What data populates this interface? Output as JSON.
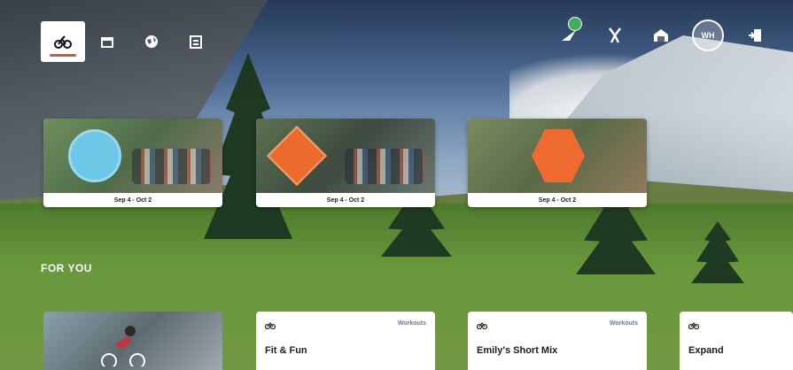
{
  "nav": {
    "left_icons": [
      {
        "name": "ride-icon",
        "active": true
      },
      {
        "name": "calendar-icon",
        "active": false
      },
      {
        "name": "world-icon",
        "active": false
      },
      {
        "name": "schedule-icon",
        "active": false
      }
    ],
    "right_icons": [
      "drops-notification-icon",
      "achievements-icon",
      "garage-icon",
      "profile-avatar",
      "exit-icon"
    ],
    "avatar_text": "WH"
  },
  "events": [
    {
      "date": "Sep 4 - Oct 2"
    },
    {
      "date": "Sep 4 - Oct 2"
    },
    {
      "date": "Sep 4 - Oct 2"
    }
  ],
  "section": {
    "for_you": "FOR YOU"
  },
  "cards": [
    {
      "title": "",
      "type": ""
    },
    {
      "title": "Fit & Fun",
      "type": "Workouts"
    },
    {
      "title": "Emily's Short Mix",
      "type": "Workouts"
    },
    {
      "title": "Expand",
      "type": ""
    }
  ],
  "colors": {
    "accent": "#e0523c",
    "badge": "#3fae5a"
  }
}
